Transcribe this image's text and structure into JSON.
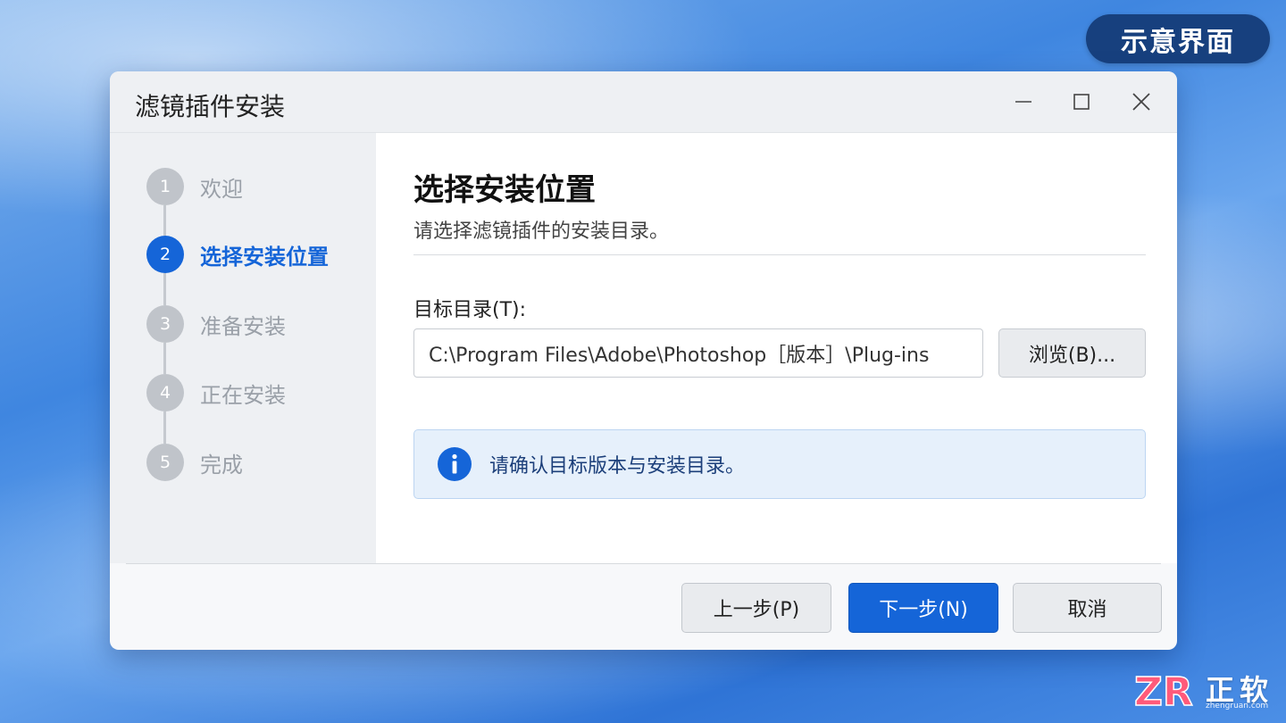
{
  "badge": "示意界面",
  "window": {
    "title": "滤镜插件安装"
  },
  "steps": [
    {
      "number": "1",
      "label": "欢迎"
    },
    {
      "number": "2",
      "label": "选择安装位置"
    },
    {
      "number": "3",
      "label": "准备安装"
    },
    {
      "number": "4",
      "label": "正在安装"
    },
    {
      "number": "5",
      "label": "完成"
    }
  ],
  "active_step": 2,
  "content": {
    "heading": "选择安装位置",
    "subheading": "请选择滤镜插件的安装目录。",
    "target_label": "目标目录(T):",
    "target_path": "C:\\Program Files\\Adobe\\Photoshop［版本］\\Plug-ins",
    "browse_label": "浏览(B)...",
    "info_text": "请确认目标版本与安装目录。"
  },
  "footer": {
    "back_label": "上一步(P)",
    "next_label": "下一步(N)",
    "cancel_label": "取消"
  },
  "watermark": {
    "mark": "ZR",
    "text": "正软",
    "sub": "zhengruan.com"
  },
  "colors": {
    "accent": "#1565d8",
    "badge": "#17407e"
  }
}
